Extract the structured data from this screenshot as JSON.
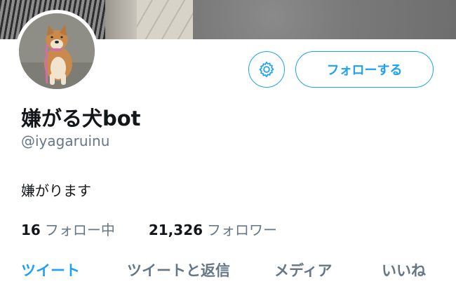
{
  "profile": {
    "display_name": "嫌がる犬bot",
    "handle": "@iyagaruinu",
    "bio": "嫌がります"
  },
  "actions": {
    "settings_icon": "gear-icon",
    "follow_label": "フォローする"
  },
  "stats": {
    "following_count": "16",
    "following_label": "フォロー中",
    "followers_count": "21,326",
    "followers_label": "フォロワー"
  },
  "tabs": [
    {
      "label": "ツイート",
      "active": true
    },
    {
      "label": "ツイートと返信",
      "active": false
    },
    {
      "label": "メディア",
      "active": false
    },
    {
      "label": "いいね",
      "active": false
    }
  ],
  "colors": {
    "accent": "#1da1f2",
    "secondary_text": "#657786",
    "primary_text": "#14171a"
  }
}
